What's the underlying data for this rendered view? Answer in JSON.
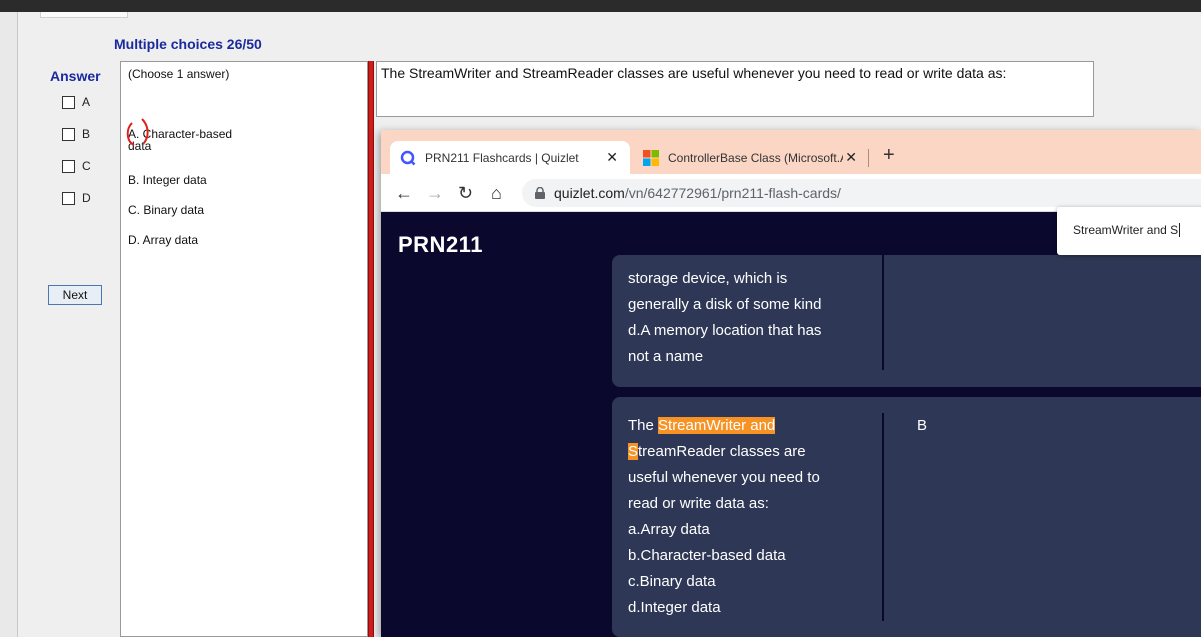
{
  "exam": {
    "header": "Multiple choices 26/50",
    "answer_label": "Answer",
    "checkboxes": [
      "A",
      "B",
      "C",
      "D"
    ],
    "next_label": "Next",
    "choose_hint": "(Choose 1 answer)",
    "choices": [
      "A. Character-based\ndata",
      "B. Integer data",
      "C. Binary data",
      "D. Array data"
    ],
    "question": "The StreamWriter and StreamReader classes are useful whenever you need to read or write data as:"
  },
  "browser": {
    "tabs": [
      {
        "title": "PRN211 Flashcards | Quizlet",
        "icon": "quizlet-icon"
      },
      {
        "title": "ControllerBase Class (Microsoft.A",
        "icon": "microsoft-icon"
      }
    ],
    "url_host": "quizlet.com",
    "url_path": "/vn/642772961/prn211-flash-cards/",
    "find_query": "StreamWriter and S",
    "site_logo": "PRN211",
    "card1": {
      "term_lines": [
        "storage device, which is",
        "generally a disk of some kind",
        "d.A memory location that has",
        "not a name"
      ]
    },
    "card2": {
      "term_prefix": "The ",
      "term_highlight": "StreamWriter and",
      "term_hl_char": "S",
      "term_rest_line2": "treamReader classes are",
      "term_lines": [
        "useful whenever you need to",
        "read or write data as:",
        "a.Array data",
        "b.Character-based data",
        "c.Binary data",
        "d.Integer data"
      ],
      "definition": "B"
    }
  },
  "colors": {
    "exam_blue": "#1a2a9c",
    "quizlet_navy": "#0a092d",
    "card_bg": "#2e3856",
    "highlight": "#f79225",
    "tabstrip": "#fbd6c5"
  }
}
